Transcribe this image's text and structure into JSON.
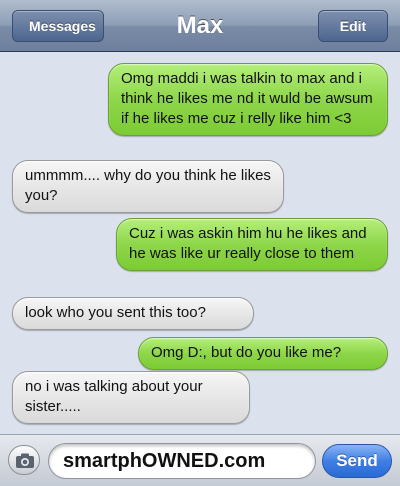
{
  "navbar": {
    "title": "Max",
    "back_label": "Messages",
    "edit_label": "Edit"
  },
  "messages": [
    {
      "direction": "sent",
      "text": "Omg maddi i was talkin to max and i think he likes me nd it wuld be awsum if he likes me cuz i relly like him <3"
    },
    {
      "direction": "received",
      "text": "ummmm.... why do you think he likes you?"
    },
    {
      "direction": "sent",
      "text": "Cuz i was askin him hu he likes and he was like ur really close to them"
    },
    {
      "direction": "received",
      "text": "look who you sent this too?"
    },
    {
      "direction": "sent",
      "text": "Omg D:, but do you like me?"
    },
    {
      "direction": "received",
      "text": "no i was talking about your sister....."
    }
  ],
  "input": {
    "value": "smartphOWNED.com",
    "send_label": "Send",
    "camera_icon": "camera-icon"
  },
  "colors": {
    "sent_bubble": "#8ed64a",
    "received_bubble": "#e4e4e4",
    "background": "#dbe2ed",
    "send_button": "#3f7fe5"
  }
}
